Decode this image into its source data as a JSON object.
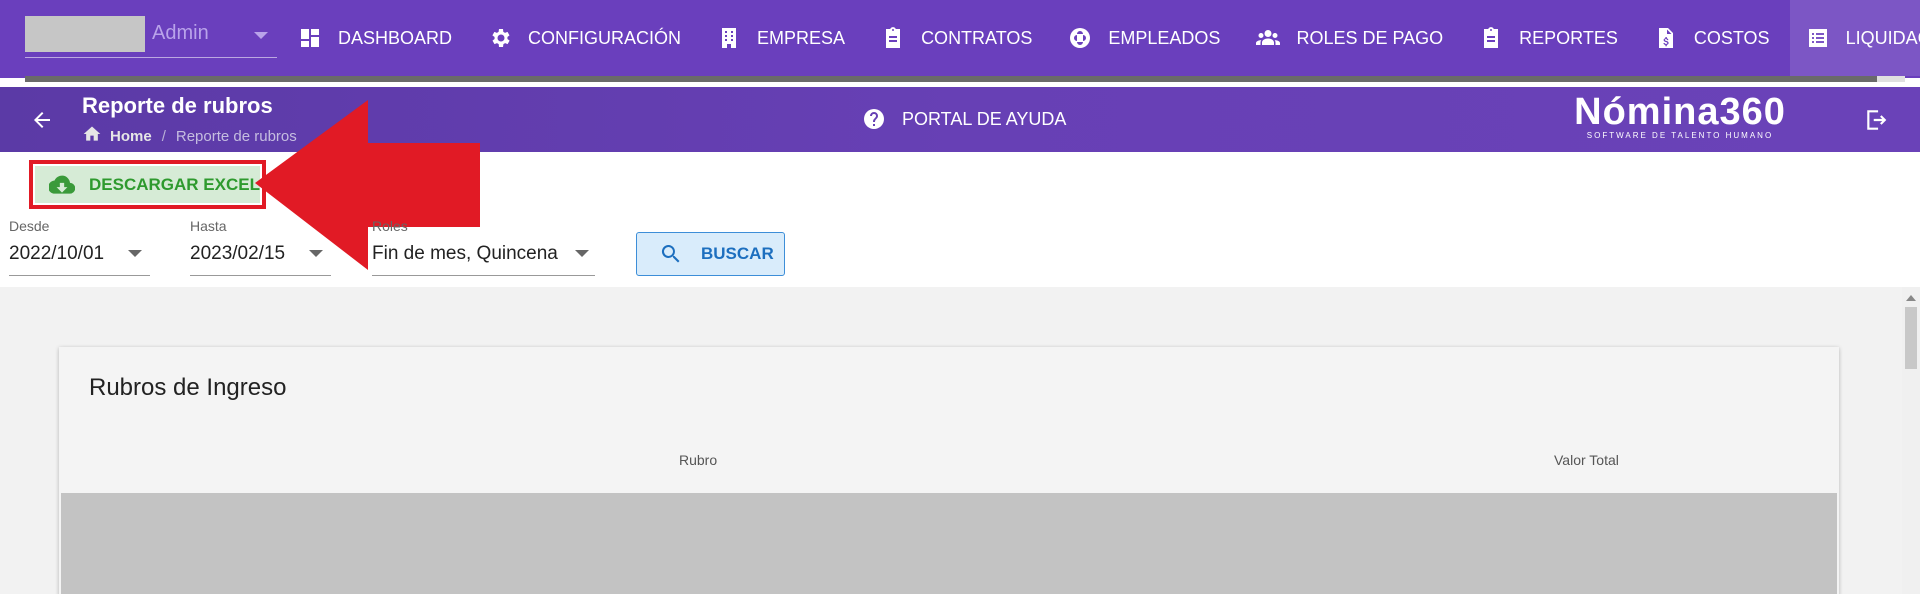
{
  "user": {
    "name": "Admin"
  },
  "nav": {
    "items": [
      {
        "label": "DASHBOARD",
        "icon": "dashboard-icon"
      },
      {
        "label": "CONFIGURACIÓN",
        "icon": "gear-icon"
      },
      {
        "label": "EMPRESA",
        "icon": "building-icon"
      },
      {
        "label": "CONTRATOS",
        "icon": "clipboard-icon"
      },
      {
        "label": "EMPLEADOS",
        "icon": "employees-icon"
      },
      {
        "label": "ROLES DE PAGO",
        "icon": "users-icon"
      },
      {
        "label": "REPORTES",
        "icon": "clipboard-list-icon"
      },
      {
        "label": "COSTOS",
        "icon": "invoice-icon"
      },
      {
        "label": "LIQUIDACIONES",
        "icon": "list-icon"
      }
    ],
    "active_index": 8,
    "progress": 0.985
  },
  "header": {
    "title": "Reporte de rubros",
    "breadcrumb": {
      "home": "Home",
      "current": "Reporte de rubros"
    },
    "help_label": "PORTAL DE AYUDA",
    "brand": {
      "name": "Nómina360",
      "tagline": "SOFTWARE DE TALENTO HUMANO"
    }
  },
  "toolbar": {
    "download_label": "DESCARGAR EXCEL",
    "highlight_color": "#e11a25"
  },
  "filters": {
    "desde": {
      "label": "Desde",
      "value": "2022/10/01"
    },
    "hasta": {
      "label": "Hasta",
      "value": "2023/02/15"
    },
    "roles": {
      "label": "Roles",
      "value": "Fin de mes, Quincena"
    },
    "search_label": "BUSCAR"
  },
  "card": {
    "title": "Rubros de Ingreso",
    "columns": [
      "Rubro",
      "Valor Total"
    ]
  },
  "colors": {
    "nav_bg": "#6a3fbd",
    "download_text": "#2e9a2e",
    "search_text": "#1d6fbf"
  }
}
